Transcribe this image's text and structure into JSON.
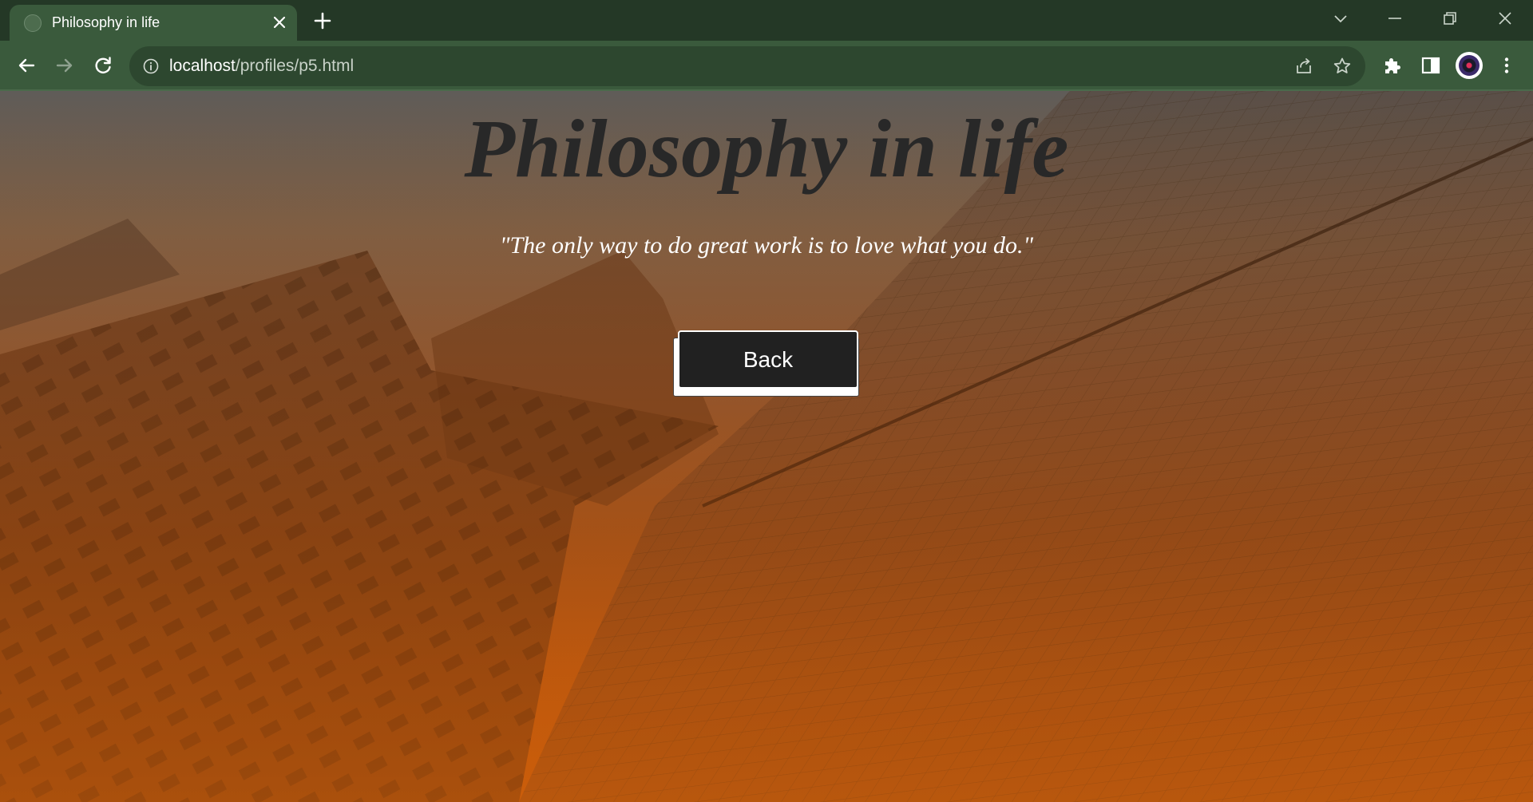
{
  "browser": {
    "tab": {
      "title": "Philosophy in life",
      "favicon": "globe-icon",
      "close_icon": "close-icon"
    },
    "new_tab_icon": "plus-icon",
    "window_controls": [
      "tab-search-icon",
      "minimize-icon",
      "restore-icon",
      "close-icon"
    ],
    "toolbar": {
      "back_icon": "arrow-left-icon",
      "forward_icon": "arrow-right-icon",
      "reload_icon": "reload-icon",
      "site_info_icon": "info-icon",
      "url_host": "localhost",
      "url_path": "/profiles/p5.html",
      "share_icon": "share-icon",
      "bookmark_icon": "star-icon",
      "extensions_icon": "puzzle-icon",
      "side_panel_icon": "side-panel-icon",
      "profile_icon": "avatar",
      "menu_icon": "kebab-menu-icon"
    },
    "colors": {
      "frame": "#243826",
      "toolbar": "#3a5a3c",
      "omnibox": "#2d472f"
    }
  },
  "page": {
    "title": "Philosophy in life",
    "quote": "\"The only way to do great work is to love what you do.\"",
    "back_button_label": "Back",
    "background_image": "low-angle view of skyscrapers with orange gradient overlay",
    "colors": {
      "title": "#282828",
      "quote": "#ffffff",
      "button_bg": "#212121",
      "button_text": "#ffffff",
      "gradient_top": "#5f5c58",
      "gradient_bottom": "#c85a08"
    }
  }
}
